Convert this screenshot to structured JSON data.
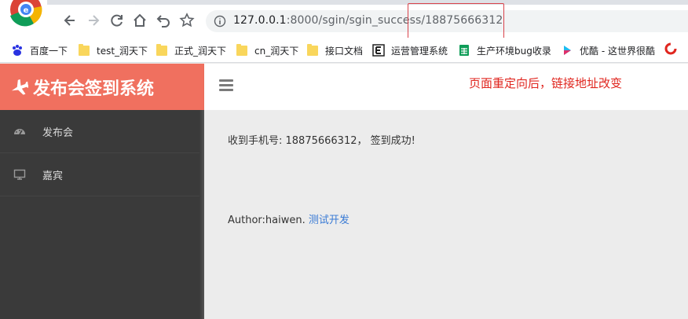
{
  "browser": {
    "url_prefix": "127.0.0.1",
    "url_rest": ":8000/sgin/sgin_success/18875666312",
    "icons": [
      "back-icon",
      "forward-icon",
      "reload-icon",
      "home-icon",
      "undo-icon",
      "star-icon",
      "info-icon"
    ]
  },
  "bookmarks": [
    {
      "label": "百度一下",
      "icon": "baidu-icon"
    },
    {
      "label": "test_润天下",
      "icon": "folder-icon"
    },
    {
      "label": "正式_润天下",
      "icon": "folder-icon"
    },
    {
      "label": "cn_润天下",
      "icon": "folder-icon"
    },
    {
      "label": "接口文档",
      "icon": "folder-icon"
    },
    {
      "label": "运营管理系统",
      "icon": "e-icon"
    },
    {
      "label": "生产环境bug收录",
      "icon": "sheet-icon"
    },
    {
      "label": "优酷 - 这世界很酷",
      "icon": "youku-icon"
    }
  ],
  "app": {
    "brand_title": "发布会签到系统",
    "annotation": "页面重定向后，链接地址改变",
    "sidebar": [
      {
        "label": "发布会",
        "icon": "dashboard-icon"
      },
      {
        "label": "嘉宾",
        "icon": "monitor-icon"
      }
    ],
    "message": "收到手机号: 18875666312， 签到成功!",
    "author_label": "Author:haiwen.",
    "author_link": "测试开发"
  },
  "colors": {
    "brand": "#f0705f",
    "sidebar": "#3a3a3a",
    "annotation": "#e0261f",
    "link": "#3a7bd5"
  }
}
